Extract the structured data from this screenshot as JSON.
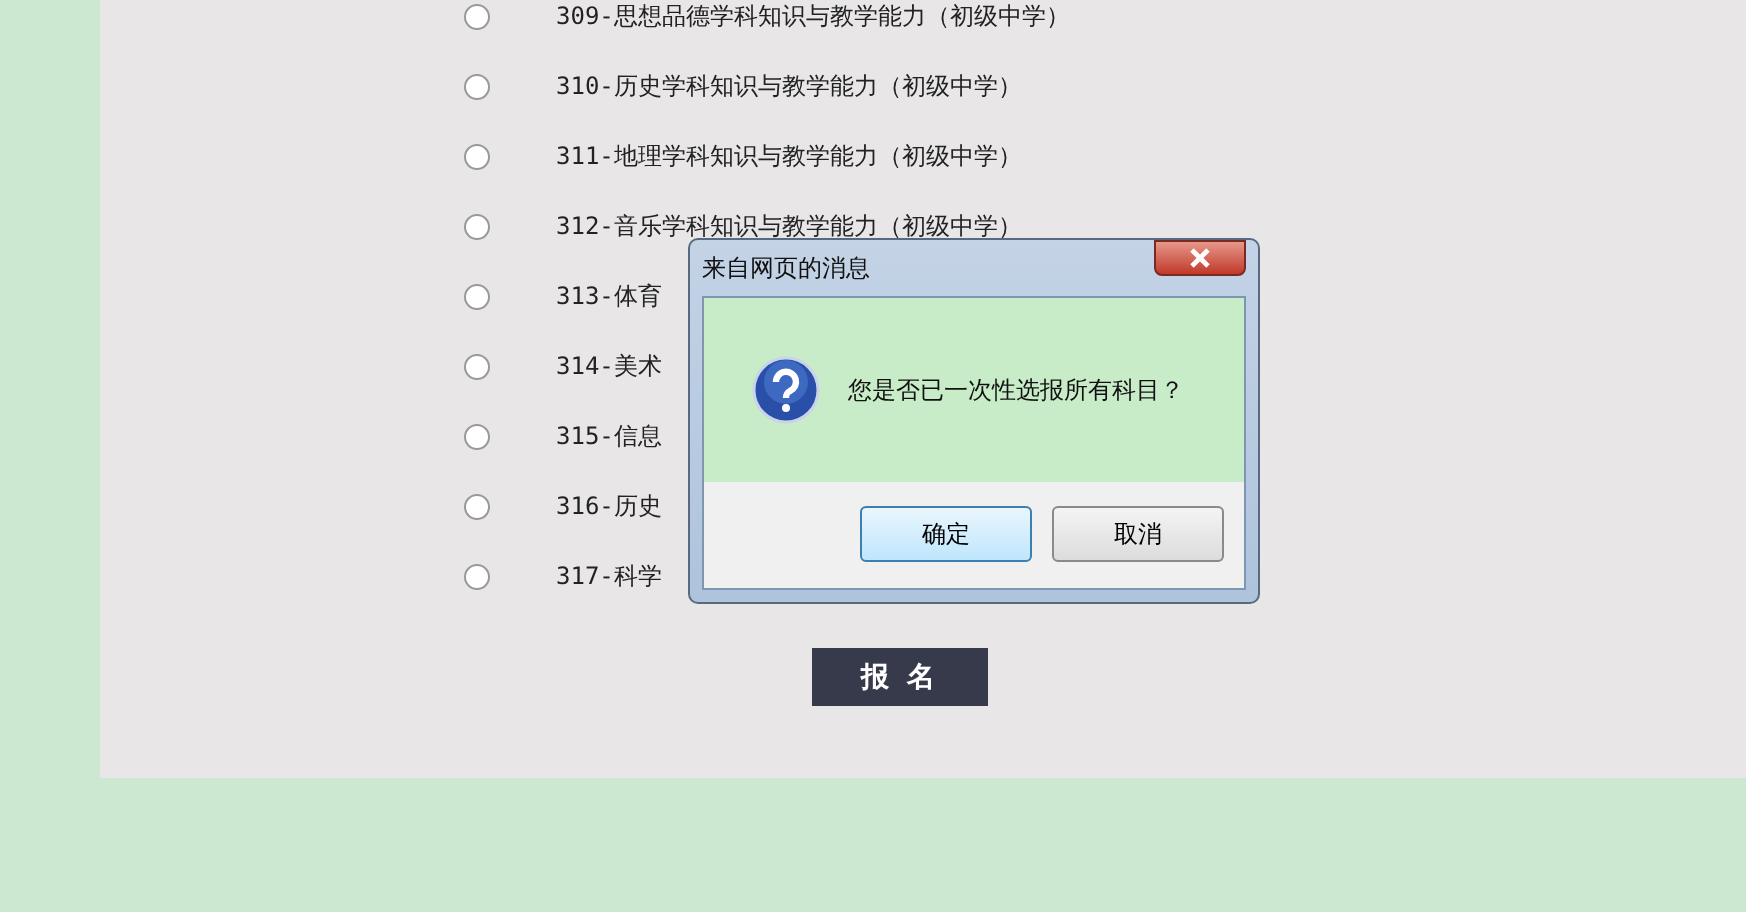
{
  "subjects": [
    {
      "label": "309-思想品德学科知识与教学能力（初级中学）",
      "selected": false
    },
    {
      "label": "310-历史学科知识与教学能力（初级中学）",
      "selected": false
    },
    {
      "label": "311-地理学科知识与教学能力（初级中学）",
      "selected": false
    },
    {
      "label": "312-音乐学科知识与教学能力（初级中学）",
      "selected": false
    },
    {
      "label": "313-体育",
      "selected": false
    },
    {
      "label": "314-美术",
      "selected": false
    },
    {
      "label": "315-信息",
      "selected": false
    },
    {
      "label": "316-历史",
      "selected": false
    },
    {
      "label": "317-科学",
      "selected": false
    }
  ],
  "submit_button": "报 名",
  "dialog": {
    "title": "来自网页的消息",
    "message": "您是否已一次性选报所有科目？",
    "buttons": [
      "确定",
      "取消"
    ]
  }
}
